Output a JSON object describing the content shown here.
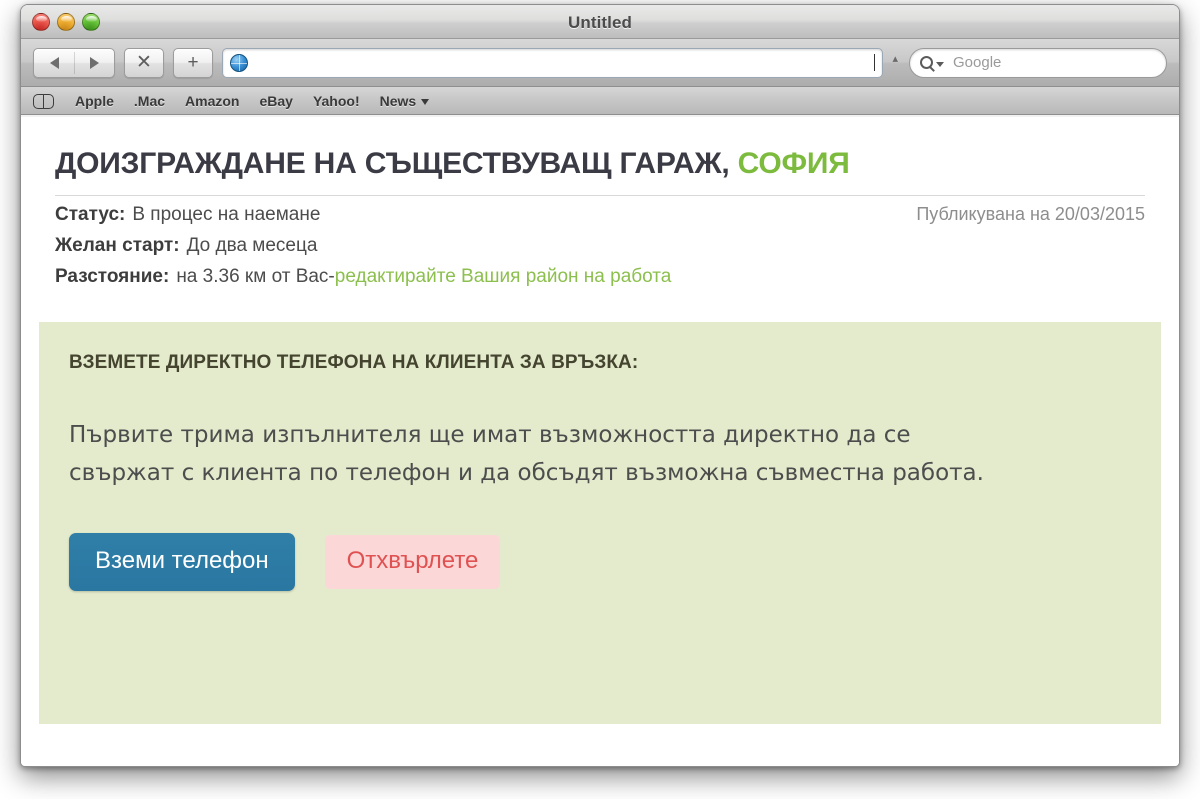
{
  "window": {
    "title": "Untitled",
    "traffic_lights": [
      "close-button",
      "minimize-button",
      "zoom-button"
    ]
  },
  "toolbar": {
    "back_icon": "back-arrow-icon",
    "forward_icon": "forward-arrow-icon",
    "stop_label": "✕",
    "add_label": "+",
    "address_value": "",
    "address_placeholder": "",
    "snapback_label": "▴",
    "search_placeholder": "Google"
  },
  "bookmarks": {
    "items": [
      {
        "label": "Apple",
        "has_menu": false
      },
      {
        "label": ".Mac",
        "has_menu": false
      },
      {
        "label": "Amazon",
        "has_menu": false
      },
      {
        "label": "eBay",
        "has_menu": false
      },
      {
        "label": "Yahoo!",
        "has_menu": false
      },
      {
        "label": "News",
        "has_menu": true
      }
    ]
  },
  "listing": {
    "title_main": "ДОИЗГРАЖДАНЕ НА СЪЩЕСТВУВАЩ ГАРАЖ, ",
    "title_city": "СОФИЯ",
    "status_label": "Статус:",
    "status_value": "В процес на наемане",
    "published_text": "Публикувана на 20/03/2015",
    "start_label": "Желан старт:",
    "start_value": "До два месеца",
    "distance_label": "Разстояние:",
    "distance_value": "на 3.36 км от Вас- ",
    "distance_link": "редактирайте Вашия район на работа"
  },
  "promo": {
    "heading": "ВЗЕМЕТЕ ДИРЕКТНО ТЕЛЕФОНА НА КЛИЕНТА ЗА ВРЪЗКА:",
    "body": "Първите трима изпълнителя ще имат възможността директно да се свържат с клиента по телефон и да обсъдят възможна съвместна работа.",
    "primary_button": "Вземи телефон",
    "secondary_button": "Отхвърлете"
  },
  "colors": {
    "accent_green": "#7dbb3e",
    "link_green": "#8cbf4d",
    "panel_green": "#e3ebcc",
    "primary_button": "#2c7ba6",
    "reject_bg": "#fbd7d7",
    "reject_text": "#e05252"
  }
}
